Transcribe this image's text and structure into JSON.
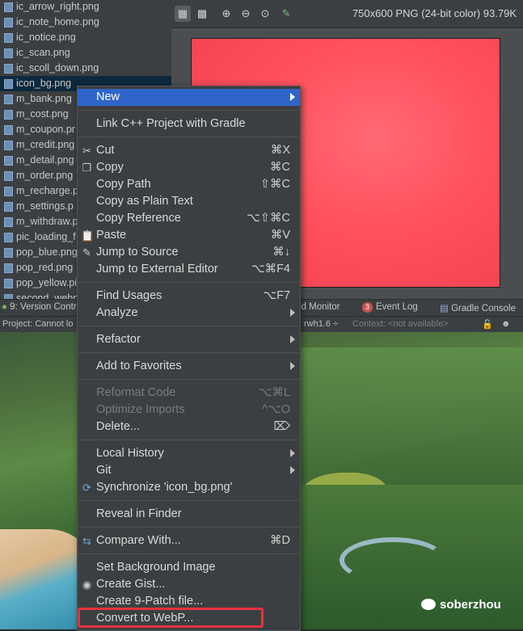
{
  "files": [
    "ic_arrow_right.png",
    "ic_note_home.png",
    "ic_notice.png",
    "ic_scan.png",
    "ic_scoll_down.png",
    "icon_bg.png",
    "m_bank.png",
    "m_cost.png",
    "m_coupon.pr",
    "m_credit.png",
    "m_detail.png",
    "m_order.png",
    "m_recharge.p",
    "m_settings.p",
    "m_withdraw.p",
    "pic_loading_f",
    "pop_blue.png",
    "pop_red.png",
    "pop_yellow.pi",
    "second_webp"
  ],
  "selected_file_index": 5,
  "viewer": {
    "info": "750x600 PNG (24-bit color) 93.79K",
    "tool_icons": [
      "grid-toggle-icon",
      "chessboard-icon",
      "zoom-in-icon",
      "zoom-out-icon",
      "actual-size-icon",
      "color-picker-icon"
    ],
    "canvas_color": "#ff505c"
  },
  "toolstrip": {
    "version_control": "9: Version Contr",
    "monitor": "id Monitor",
    "event_log_count": "3",
    "event_log": "Event Log",
    "gradle_console": "Gradle Console"
  },
  "statusbar": {
    "project": "Project: Cannot lo",
    "branch": "rwh1.6 ÷",
    "context": "Context: <not available>"
  },
  "menu": {
    "new": {
      "label": "New"
    },
    "link_cpp": {
      "label": "Link C++ Project with Gradle"
    },
    "cut": {
      "label": "Cut",
      "shortcut": "⌘X"
    },
    "copy": {
      "label": "Copy",
      "shortcut": "⌘C"
    },
    "copy_path": {
      "label": "Copy Path",
      "shortcut": "⇧⌘C"
    },
    "copy_plain": {
      "label": "Copy as Plain Text"
    },
    "copy_ref": {
      "label": "Copy Reference",
      "shortcut": "⌥⇧⌘C"
    },
    "paste": {
      "label": "Paste",
      "shortcut": "⌘V"
    },
    "jump_source": {
      "label": "Jump to Source",
      "shortcut": "⌘↓"
    },
    "jump_external": {
      "label": "Jump to External Editor",
      "shortcut": "⌥⌘F4"
    },
    "find_usages": {
      "label": "Find Usages",
      "shortcut": "⌥F7"
    },
    "analyze": {
      "label": "Analyze"
    },
    "refactor": {
      "label": "Refactor"
    },
    "favorites": {
      "label": "Add to Favorites"
    },
    "reformat": {
      "label": "Reformat Code",
      "shortcut": "⌥⌘L"
    },
    "optimize": {
      "label": "Optimize Imports",
      "shortcut": "^⌥O"
    },
    "delete": {
      "label": "Delete...",
      "shortcut": "⌦"
    },
    "local_history": {
      "label": "Local History"
    },
    "git": {
      "label": "Git"
    },
    "synchronize": {
      "label": "Synchronize 'icon_bg.png'"
    },
    "reveal": {
      "label": "Reveal in Finder"
    },
    "compare": {
      "label": "Compare With...",
      "shortcut": "⌘D"
    },
    "set_bg": {
      "label": "Set Background Image"
    },
    "gist": {
      "label": "Create Gist..."
    },
    "nine_patch": {
      "label": "Create 9-Patch file..."
    },
    "webp": {
      "label": "Convert to WebP..."
    }
  },
  "watermark": "soberzhou",
  "colors": {
    "menu_highlight": "#2f65ca",
    "callout_border": "#e8323c"
  }
}
